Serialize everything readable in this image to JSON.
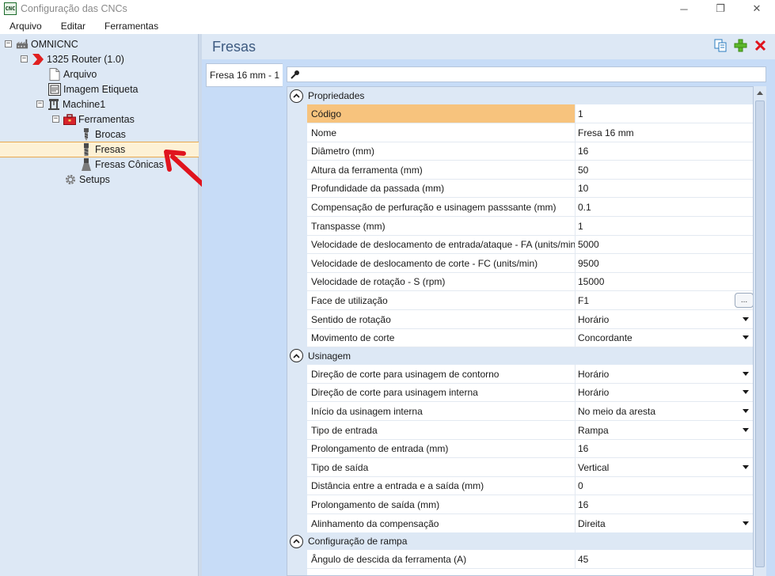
{
  "window": {
    "icon_text": "CNC",
    "title": "Configuração das CNCs"
  },
  "window_controls": {
    "minimize": "─",
    "restore": "❐",
    "close": "✕"
  },
  "menu": [
    "Arquivo",
    "Editar",
    "Ferramentas"
  ],
  "tree": {
    "root": "OMNICNC",
    "machine_router": "1325 Router (1.0)",
    "file": "Arquivo",
    "label_image": "Imagem Etiqueta",
    "machine": "Machine1",
    "tools": "Ferramentas",
    "drills": "Brocas",
    "mills": "Fresas",
    "conical_mills": "Fresas Cônicas",
    "setups": "Setups",
    "expander_minus": "−"
  },
  "panel": {
    "title": "Fresas"
  },
  "tabs": [
    "Fresa 16 mm - 1"
  ],
  "search": {
    "placeholder": ""
  },
  "grid": {
    "ellipsis": "...",
    "categories": [
      {
        "label": "Propriedades",
        "rows": [
          {
            "name": "Código",
            "value": "1"
          },
          {
            "name": "Nome",
            "value": "Fresa 16 mm"
          },
          {
            "name": "Diâmetro (mm)",
            "value": "16"
          },
          {
            "name": "Altura da ferramenta (mm)",
            "value": "50"
          },
          {
            "name": "Profundidade da passada (mm)",
            "value": "10"
          },
          {
            "name": "Compensação de perfuração e usinagem passsante (mm)",
            "value": "0.1"
          },
          {
            "name": "Transpasse (mm)",
            "value": "1"
          },
          {
            "name": "Velocidade de deslocamento de entrada/ataque - FA (units/min)",
            "value": "5000"
          },
          {
            "name": "Velocidade de deslocamento de corte - FC (units/min)",
            "value": "9500"
          },
          {
            "name": "Velocidade de rotação - S (rpm)",
            "value": "15000"
          },
          {
            "name": "Face de utilização",
            "value": "F1"
          },
          {
            "name": "Sentido de rotação",
            "value": "Horário"
          },
          {
            "name": "Movimento de corte",
            "value": "Concordante"
          }
        ]
      },
      {
        "label": "Usinagem",
        "rows": [
          {
            "name": "Direção de corte para usinagem de contorno",
            "value": "Horário"
          },
          {
            "name": "Direção de corte para usinagem interna",
            "value": "Horário"
          },
          {
            "name": "Início da usinagem interna",
            "value": "No meio da aresta"
          },
          {
            "name": "Tipo de entrada",
            "value": "Rampa"
          },
          {
            "name": "Prolongamento de entrada (mm)",
            "value": "16"
          },
          {
            "name": "Tipo de saída",
            "value": "Vertical"
          },
          {
            "name": "Distância entre a entrada e a saída (mm)",
            "value": "0"
          },
          {
            "name": "Prolongamento de saída (mm)",
            "value": "16"
          },
          {
            "name": "Alinhamento da compensação",
            "value": "Direita"
          }
        ]
      },
      {
        "label": "Configuração de rampa",
        "rows": [
          {
            "name": "Ângulo de descida da ferramenta (A)",
            "value": "45"
          }
        ]
      }
    ]
  },
  "colors": {
    "selection_fill": "#f7c37d",
    "tree_selected": "#fdf1d5",
    "accent_title": "#3d5a80",
    "annotation_arrow": "#e0141e"
  }
}
